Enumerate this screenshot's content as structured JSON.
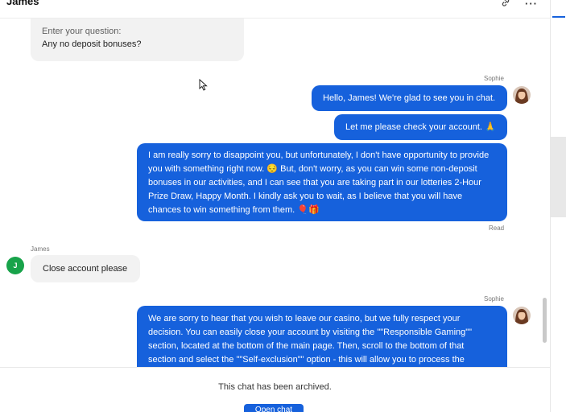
{
  "header": {
    "title": "James",
    "link_icon": "link-icon",
    "more_icon": "more-icon"
  },
  "messages": {
    "customer_prompt": {
      "label": "Enter your question:",
      "text": "Any no deposit bonuses?"
    },
    "agent_block_1": {
      "sender": "Sophie",
      "m1": "Hello, James! We're glad to see you in chat.",
      "m2": "Let me please check your account. 🙏",
      "m3_lines": [
        "I am really sorry to disappoint you, but unfortunately, I don't have opportunity to provide",
        "you with something right now. 😔 But, don't worry, as you can win some non-deposit",
        "bonuses in our activities, and I can see that you are taking part in our lotteries 2-Hour",
        "Prize Draw, Happy Month. I kindly ask you to wait, as I believe that you will have",
        "chances to win something from them. 🎈🎁"
      ],
      "read_status": "Read"
    },
    "customer_2": {
      "sender": "James",
      "avatar_letter": "J",
      "text": "Close account please"
    },
    "agent_block_2": {
      "sender": "Sophie",
      "lines": [
        "We are sorry to hear that you wish to leave our casino, but we fully respect your",
        "decision. You can easily close your account by visiting the \"\"Responsible Gaming\"\"",
        "section, located at the bottom of the main page. Then, scroll to the bottom of that",
        "section and select the \"\"Self-exclusion\"\" option - this will allow you to process the"
      ]
    }
  },
  "footer": {
    "archived_text": "This chat has been archived.",
    "button_label": "Open chat"
  },
  "colors": {
    "accent": "#1661dc",
    "customer_bubble": "#f2f2f2",
    "avatar_green": "#18a34a"
  }
}
